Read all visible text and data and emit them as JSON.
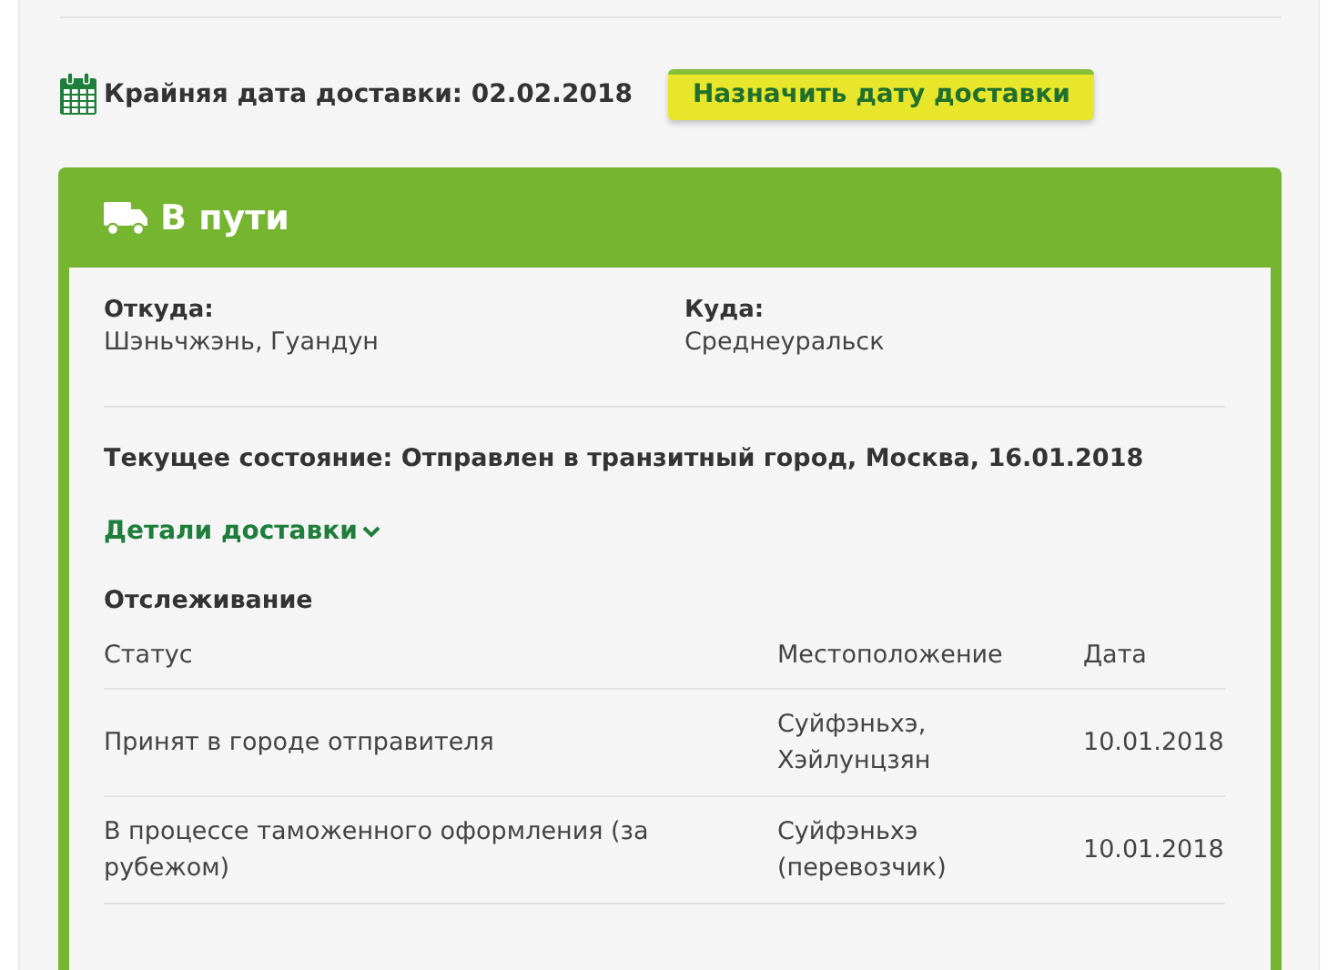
{
  "deadline": {
    "text": "Крайняя дата доставки: 02.02.2018"
  },
  "schedule_button": "Назначить дату доставки",
  "shipment": {
    "title": "В пути",
    "from": {
      "label": "Откуда:",
      "value": "Шэньчжэнь, Гуандун"
    },
    "to": {
      "label": "Куда:",
      "value": "Среднеуральск"
    },
    "current_status": "Текущее состояние: Отправлен в транзитный город, Москва, 16.01.2018",
    "details_link": "Детали доставки",
    "tracking": {
      "title": "Отслеживание",
      "columns": [
        "Статус",
        "Местоположение",
        "Дата"
      ],
      "rows": [
        {
          "status": "Принят в городе отправителя",
          "location": "Суйфэньхэ, Хэйлунцзян",
          "date": "10.01.2018"
        },
        {
          "status": "В процессе таможенного оформления (за рубежом)",
          "location": "Суйфэньхэ (перевозчик)",
          "date": "10.01.2018"
        }
      ]
    }
  }
}
